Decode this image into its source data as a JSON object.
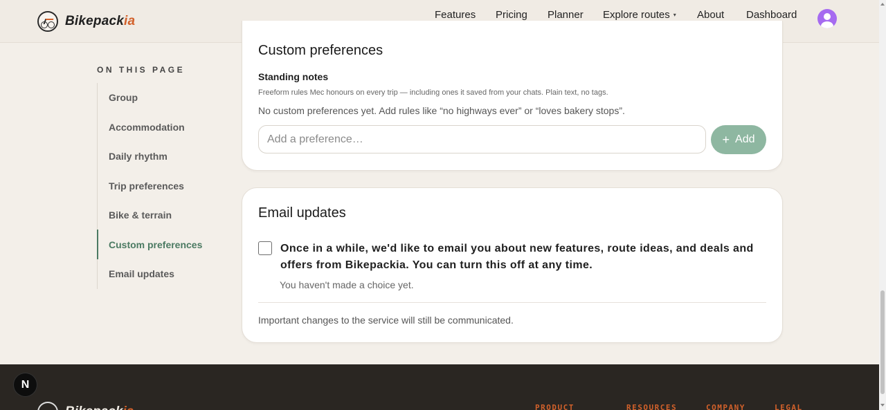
{
  "brand": {
    "name_main": "Bikepack",
    "name_accent": "ia"
  },
  "nav": {
    "items": [
      "Features",
      "Pricing",
      "Planner",
      "Explore routes",
      "About",
      "Dashboard"
    ],
    "caret": "▾"
  },
  "toc": {
    "title": "ON THIS PAGE",
    "items": [
      "Group",
      "Accommodation",
      "Daily rhythm",
      "Trip preferences",
      "Bike & terrain",
      "Custom preferences",
      "Email updates"
    ],
    "active": "Custom preferences"
  },
  "custom_preferences": {
    "title": "Custom preferences",
    "subtitle": "Standing notes",
    "hint": "Freeform rules Mec honours on every trip — including ones it saved from your chats. Plain text, no tags.",
    "empty_text": "No custom preferences yet. Add rules like “no highways ever” or “loves bakery stops”.",
    "input_placeholder": "Add a preference…",
    "input_value": "",
    "add_label": "Add",
    "add_icon": "plus-icon"
  },
  "email_updates": {
    "title": "Email updates",
    "consent_text": "Once in a while, we'd like to email you about new features, route ideas, and deals and offers from Bikepackia. You can turn this off at any time.",
    "checked": false,
    "choice_status": "You haven't made a choice yet.",
    "note": "Important changes to the service will still be communicated."
  },
  "footer": {
    "badge": "N",
    "columns": [
      "PRODUCT",
      "RESOURCES",
      "COMPANY",
      "LEGAL"
    ]
  },
  "colors": {
    "accent": "#d2612b",
    "green": "#4b7a62",
    "add_button": "#8eb7a1",
    "avatar": "#a66bf0",
    "footer_bg": "#2a2622"
  }
}
